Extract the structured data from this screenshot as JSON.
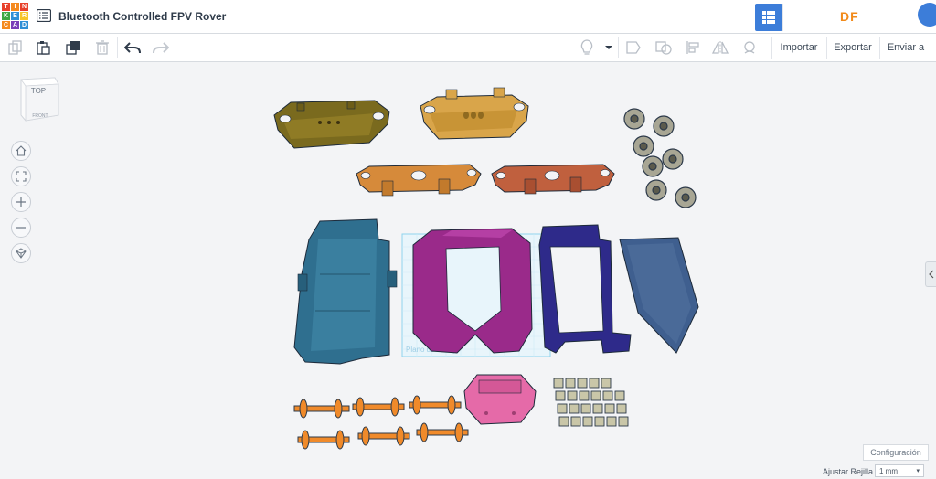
{
  "logo": {
    "letters": [
      "T",
      "I",
      "N",
      "K",
      "E",
      "R",
      "C",
      "A",
      "D"
    ]
  },
  "header": {
    "title": "Bluetooth Controlled FPV Rover",
    "watermark": "DF"
  },
  "toolbar": {
    "import_label": "Importar",
    "export_label": "Exportar",
    "send_label": "Enviar a"
  },
  "viewcube": {
    "top_label": "TOP",
    "front_label": "FRONT"
  },
  "workplane": {
    "label": "Plano de trabajo"
  },
  "footer": {
    "config_label": "Configuración",
    "grid_label": "Ajustar Rejilla",
    "grid_value": "1 mm"
  },
  "colors": {
    "accent": "#3c7dd9",
    "brand_orange": "#f28a1a",
    "olive_part": "#7a6a1e",
    "tan_part": "#d9a54a",
    "orange_part": "#d68a3a",
    "rust_part": "#c0603e",
    "teal_part": "#2f6f8f",
    "magenta_part": "#9a2a8a",
    "navy_part": "#2e2a8a",
    "slate_part": "#3f5f8f",
    "pink_part": "#e56aa8",
    "wheel_part": "#f08a2a",
    "gear_part": "#a8a694"
  }
}
